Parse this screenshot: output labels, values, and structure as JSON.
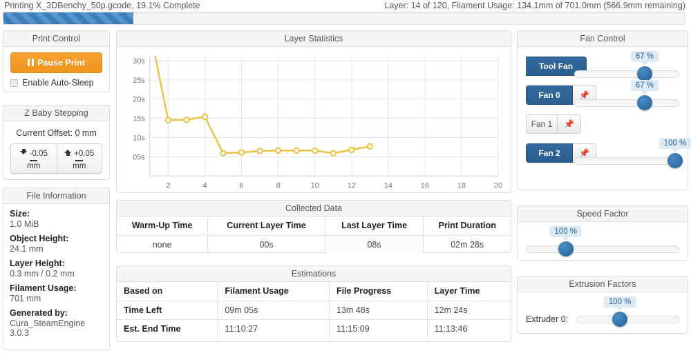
{
  "header": {
    "status_left": "Printing X_3DBenchy_50p.gcode, 19.1% Complete",
    "status_right": "Layer: 14 of 120, Filament Usage: 134.1mm of 701.0mm (566.9mm remaining)",
    "progress_percent": 19.1,
    "progress_color": "#3a7fbd"
  },
  "print_control": {
    "title": "Print Control",
    "pause_label": "Pause Print",
    "pause_color": "#f0941c",
    "autosleep_label": "Enable Auto-Sleep",
    "autosleep_checked": false
  },
  "z_baby_stepping": {
    "title": "Z Baby Stepping",
    "current_offset": "Current Offset: 0 mm",
    "buttons": [
      {
        "label": "-0.05",
        "unit": "mm",
        "icon": "arrow-down-to-bar-icon"
      },
      {
        "label": "+0.05",
        "unit": "mm",
        "icon": "arrow-up-from-bar-icon"
      }
    ]
  },
  "file_information": {
    "title": "File Information",
    "rows": [
      {
        "key": "Size:",
        "value": "1.0 MiB"
      },
      {
        "key": "Object Height:",
        "value": "24.1 mm"
      },
      {
        "key": "Layer Height:",
        "value": "0.3 mm / 0.2 mm"
      },
      {
        "key": "Filament Usage:",
        "value": "701 mm"
      },
      {
        "key": "Generated by:",
        "value": "Cura_SteamEngine 3.0.3"
      }
    ]
  },
  "layer_statistics": {
    "title": "Layer Statistics"
  },
  "chart_data": {
    "type": "line",
    "title": "Layer Statistics",
    "xlabel": "",
    "ylabel": "",
    "x": [
      1,
      2,
      3,
      4,
      5,
      6,
      7,
      8,
      9,
      10,
      11,
      12,
      13
    ],
    "values": [
      38,
      14.5,
      14.6,
      15.4,
      5.9,
      6.1,
      6.5,
      6.6,
      6.6,
      6.6,
      5.9,
      6.8,
      7.7
    ],
    "series": [
      {
        "name": "Layer Time",
        "values": [
          38,
          14.5,
          14.6,
          15.4,
          5.9,
          6.1,
          6.5,
          6.6,
          6.6,
          6.6,
          5.9,
          6.8,
          7.7
        ]
      }
    ],
    "xlim": [
      1,
      20
    ],
    "ylim": [
      0,
      31
    ],
    "xticks": [
      2,
      4,
      6,
      8,
      10,
      12,
      14,
      16,
      18,
      20
    ],
    "xticklabels": [
      "2",
      "4",
      "6",
      "8",
      "10",
      "12",
      "14",
      "16",
      "18",
      "20"
    ],
    "yticks": [
      5,
      10,
      15,
      20,
      25,
      30
    ],
    "yticklabels": [
      "05s",
      "10s",
      "15s",
      "20s",
      "25s",
      "30s"
    ],
    "line_color": "#ecc242",
    "marker": "circle",
    "grid": true,
    "legend": "none"
  },
  "collected_data": {
    "title": "Collected Data",
    "columns": [
      "Warm-Up Time",
      "Current Layer Time",
      "Last Layer Time",
      "Print Duration"
    ],
    "values": [
      "none",
      "00s",
      "08s",
      "02m 28s"
    ],
    "highlight_index": 2
  },
  "estimations": {
    "title": "Estimations",
    "columns": [
      "Based on",
      "Filament Usage",
      "File Progress",
      "Layer Time"
    ],
    "rows": [
      {
        "label": "Time Left",
        "cells": [
          "09m 05s",
          "13m 48s",
          "12m 24s"
        ]
      },
      {
        "label": "Est. End Time",
        "cells": [
          "11:10:27",
          "11:15:09",
          "11:13:46"
        ]
      }
    ]
  },
  "fan_control": {
    "title": "Fan Control",
    "rows": [
      {
        "label": "Tool Fan",
        "active": true,
        "has_pin": false,
        "value": "67 %",
        "percent": 67
      },
      {
        "label": "Fan 0",
        "active": true,
        "has_pin": true,
        "value": "67 %",
        "percent": 67
      },
      {
        "label": "Fan 1",
        "active": false,
        "has_pin": true,
        "value": "",
        "percent": null
      },
      {
        "label": "Fan 2",
        "active": true,
        "has_pin": true,
        "value": "100 %",
        "percent": 100
      }
    ],
    "pin_icon": "pin-icon"
  },
  "speed_factor": {
    "title": "Speed Factor",
    "value": "100 %",
    "percent": 100,
    "knob_position_percent": 26
  },
  "extrusion_factors": {
    "title": "Extrusion Factors",
    "label": "Extruder 0:",
    "value": "100 %",
    "percent": 100,
    "knob_position_percent": 42
  }
}
